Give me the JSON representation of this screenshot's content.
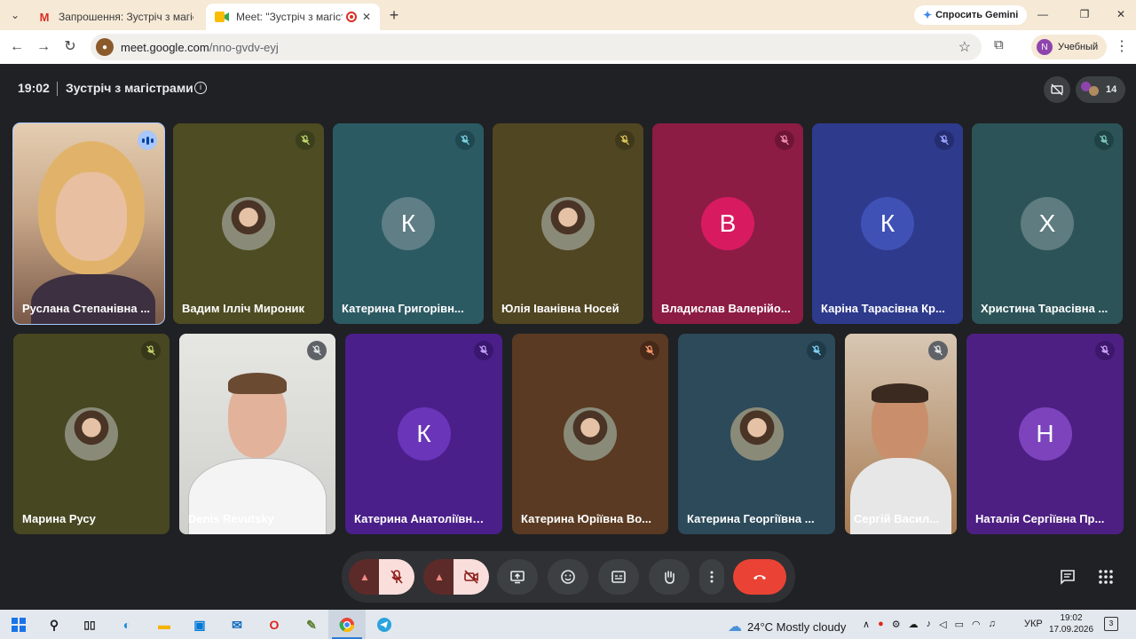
{
  "browser": {
    "tabs": [
      {
        "title": "Запрошення: Зустріч з магістрами",
        "active": false
      },
      {
        "title": "Meet: \"Зустріч з магістрами\"",
        "active": true
      }
    ],
    "gemini_label": "Спросить Gemini",
    "url_host": "meet.google.com",
    "url_path": "/nno-gvdv-eyj",
    "profile_initial": "N",
    "profile_name": "Учебный"
  },
  "meet": {
    "time": "19:02",
    "title": "Зустріч з магістрами",
    "participant_count": "14",
    "participants": [
      {
        "name": "Руслана Степанівна ...",
        "bg": "#c9a68a",
        "type": "video",
        "speaking": true
      },
      {
        "name": "Вадим Ілліч Мироник",
        "bg": "#4d4c22",
        "type": "photo",
        "mute_bg": "#3c3f1c",
        "mute_color": "#c5d86d"
      },
      {
        "name": "Катерина Григорівн...",
        "bg": "#2c5a63",
        "type": "letter",
        "letter": "К",
        "avatar_bg": "#5f7e86",
        "mute_bg": "#1f4850",
        "mute_color": "#7fd7e8"
      },
      {
        "name": "Юлія Іванівна Носей",
        "bg": "#504622",
        "type": "photo",
        "mute_bg": "#3f381a",
        "mute_color": "#e0c95a"
      },
      {
        "name": "Владислав Валерійо...",
        "bg": "#8c1c43",
        "type": "letter",
        "letter": "В",
        "avatar_bg": "#d81b60",
        "mute_bg": "#6e1535",
        "mute_color": "#f48fb1"
      },
      {
        "name": "Каріна Тарасівна Кр...",
        "bg": "#2e3a8c",
        "type": "letter",
        "letter": "К",
        "avatar_bg": "#3f51b5",
        "mute_bg": "#232d70",
        "mute_color": "#9fa8ff"
      },
      {
        "name": "Христина Тарасівна ...",
        "bg": "#2c5458",
        "type": "letter",
        "letter": "Х",
        "avatar_bg": "#5f7c80",
        "mute_bg": "#1f4245",
        "mute_color": "#80cbc4"
      },
      {
        "name": "Марина Русу",
        "bg": "#474722",
        "type": "photo",
        "mute_bg": "#37371a",
        "mute_color": "#c5d86d"
      },
      {
        "name": "Denis Revutsky",
        "bg": "#d8d8d4",
        "type": "video2",
        "mute_bg": "#5f6368",
        "mute_color": "#e8eaed"
      },
      {
        "name": "Катерина Анатоліївна...",
        "bg": "#4a1f8a",
        "type": "letter",
        "letter": "К",
        "avatar_bg": "#6a35b8",
        "mute_bg": "#3a176e",
        "mute_color": "#c9a6ff"
      },
      {
        "name": "Катерина Юріївна Во...",
        "bg": "#5a3a22",
        "type": "photo",
        "mute_bg": "#47291a",
        "mute_color": "#ff9e6d"
      },
      {
        "name": "Катерина Георгіївна ...",
        "bg": "#2c4a5a",
        "type": "photo",
        "mute_bg": "#1f3a48",
        "mute_color": "#80d8ff"
      },
      {
        "name": "Сергій Васил...",
        "bg": "#c49a70",
        "type": "video3",
        "mute_bg": "#5f6368",
        "mute_color": "#e8eaed"
      },
      {
        "name": "Наталія Сергіївна Пр...",
        "bg": "#4e1f82",
        "type": "letter",
        "letter": "Н",
        "avatar_bg": "#7c43bd",
        "mute_bg": "#3d176a",
        "mute_color": "#d1a6ff"
      }
    ]
  },
  "taskbar": {
    "weather": "24°C  Mostly cloudy",
    "lang": "УКР",
    "time": "19:02",
    "date": "17.09.2026",
    "notif_count": "3"
  },
  "colors": {
    "accent": "#a8c7fa",
    "hangup": "#ea4335",
    "muted_bg": "#f9dedc"
  }
}
